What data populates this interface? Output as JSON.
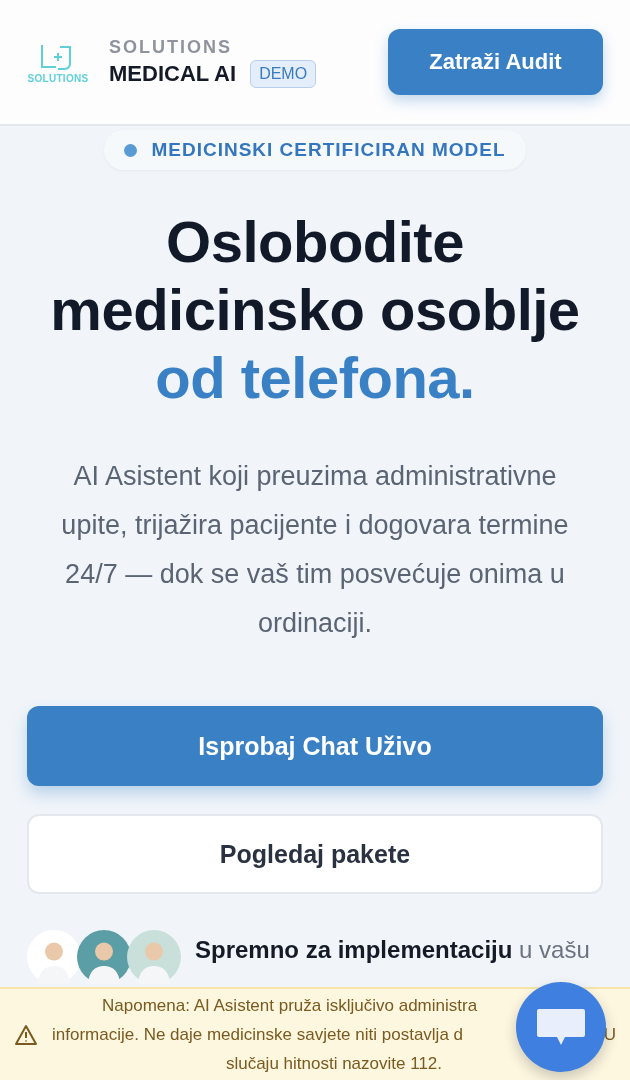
{
  "header": {
    "logo_text": "SOLUTIONS",
    "brand_top": "SOLUTIONS",
    "brand_name": "MEDICAL AI",
    "badge": "DEMO",
    "cta": "Zatraži Audit"
  },
  "hero": {
    "pill": "MEDICINSKI CERTIFICIRAN MODEL",
    "title_lines": [
      "Oslobodite",
      "medicinsko osoblje"
    ],
    "title_accent": "od telefona.",
    "lead": "AI Asistent koji preuzima administrativne upite, trijažira pacijente i dogovara termine 24/7 — dok se vaš tim posvećuje onima u ordinaciji.",
    "primary_button": "Isprobaj Chat Uživo",
    "secondary_button": "Pogledaj pakete"
  },
  "social_proof": {
    "avatars": [
      {
        "color": "#ffffff"
      },
      {
        "color": "#5b9ea6"
      },
      {
        "color": "#c9dfd9"
      }
    ],
    "text": "**Spremno za implementaciju** u vašu"
  },
  "notice": {
    "lines": [
      "Napomena: AI Asistent pruža isključivo administra",
      "informacije. Ne daje medicinske savjete niti postavlja d",
      "slučaju hitnosti nazovite 112."
    ],
    "tail": "U"
  }
}
